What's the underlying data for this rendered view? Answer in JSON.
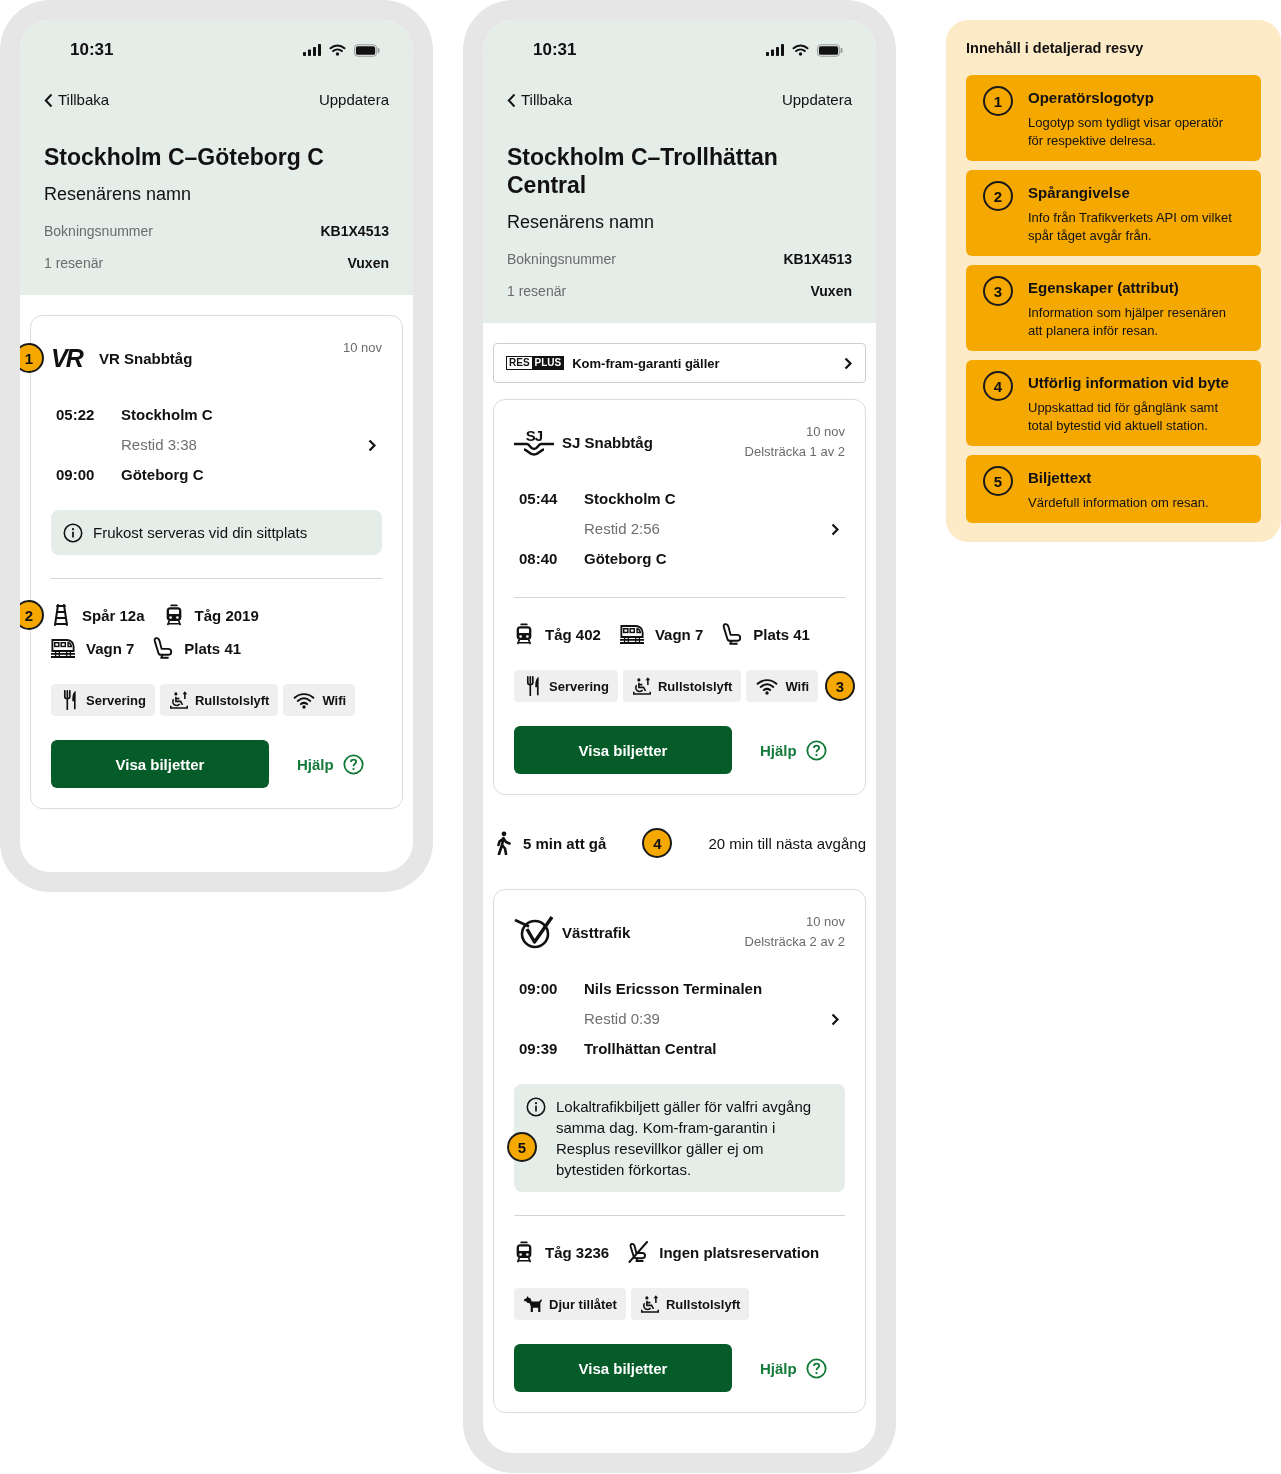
{
  "phones": [
    {
      "status_bar": {
        "time": "10:31"
      },
      "nav": {
        "back": "Tillbaka",
        "action": "Uppdatera"
      },
      "header": {
        "title": "Stockholm C–Göteborg C",
        "passenger": "Resenärens namn",
        "details": [
          {
            "label": "Bokningsnummer",
            "value": "KB1X4513"
          },
          {
            "label": "1 resenär",
            "value": "Vuxen"
          }
        ]
      },
      "sections": [
        {
          "kind": "leg",
          "operator": {
            "logo": {
              "kind": "italic-letters",
              "text": "VR"
            },
            "name": "VR Snabbtåg",
            "marker": "1"
          },
          "date": "10 nov",
          "departure": {
            "time": "05:22",
            "station": "Stockholm C"
          },
          "duration": "Restid 3:38",
          "arrival": {
            "time": "09:00",
            "station": "Göteborg C"
          },
          "notice": {
            "text": "Frukost serveras vid din sittplats"
          },
          "fact_rows": [
            {
              "marker": "2",
              "facts": [
                {
                  "kind": "track",
                  "text": "Spår 12a"
                },
                {
                  "kind": "train",
                  "text": "Tåg 2019"
                }
              ]
            },
            {
              "facts": [
                {
                  "kind": "carriage",
                  "text": "Vagn 7"
                },
                {
                  "kind": "seat",
                  "text": "Plats 41"
                }
              ]
            }
          ],
          "amenities": {
            "items": [
              {
                "kind": "dining",
                "text": "Servering"
              },
              {
                "kind": "wheelchair-lift",
                "text": "Rullstolslyft"
              },
              {
                "kind": "wifi",
                "text": "Wifi"
              }
            ]
          },
          "actions": {
            "primary": "Visa biljetter",
            "help": "Hjälp"
          }
        }
      ]
    },
    {
      "status_bar": {
        "time": "10:31"
      },
      "nav": {
        "back": "Tillbaka",
        "action": "Uppdatera"
      },
      "header": {
        "title": "Stockholm C–Trollhättan Central",
        "passenger": "Resenärens namn",
        "details": [
          {
            "label": "Bokningsnummer",
            "value": "KB1X4513"
          },
          {
            "label": "1 resenär",
            "value": "Vuxen"
          }
        ]
      },
      "sections": [
        {
          "kind": "guarantee",
          "logo_parts": [
            "RES",
            "PLUS"
          ],
          "text": "Kom-fram-garanti gäller"
        },
        {
          "kind": "leg",
          "operator": {
            "logo": {
              "kind": "letters-waves",
              "text": "SJ"
            },
            "name": "SJ Snabbtåg"
          },
          "date": "10 nov",
          "segment": "Delsträcka 1 av 2",
          "departure": {
            "time": "05:44",
            "station": "Stockholm C"
          },
          "duration": "Restid 2:56",
          "arrival": {
            "time": "08:40",
            "station": "Göteborg C"
          },
          "fact_rows": [
            {
              "facts": [
                {
                  "kind": "train",
                  "text": "Tåg 402"
                },
                {
                  "kind": "carriage",
                  "text": "Vagn 7"
                },
                {
                  "kind": "seat",
                  "text": "Plats 41"
                }
              ]
            }
          ],
          "amenities": {
            "items": [
              {
                "kind": "dining",
                "text": "Servering"
              },
              {
                "kind": "wheelchair-lift",
                "text": "Rullstolslyft"
              },
              {
                "kind": "wifi",
                "text": "Wifi"
              }
            ],
            "marker": "3"
          },
          "actions": {
            "primary": "Visa biljetter",
            "help": "Hjälp"
          }
        },
        {
          "kind": "transfer",
          "walk": "5 min att gå",
          "marker": "4",
          "wait": "20 min till nästa avgång"
        },
        {
          "kind": "leg",
          "operator": {
            "logo": {
              "kind": "ring-tick"
            },
            "name": "Västtrafik"
          },
          "date": "10 nov",
          "segment": "Delsträcka 2 av 2",
          "departure": {
            "time": "09:00",
            "station": "Nils Ericsson Terminalen"
          },
          "duration": "Restid 0:39",
          "arrival": {
            "time": "09:39",
            "station": "Trollhättan Central"
          },
          "notice": {
            "text": "Lokaltrafikbiljett gäller för valfri avgång samma dag. Kom-fram-garantin i Resplus resevillkor gäller ej om bytestiden förkortas.",
            "marker": "5"
          },
          "fact_rows": [
            {
              "facts": [
                {
                  "kind": "train",
                  "text": "Tåg 3236"
                },
                {
                  "kind": "no-seat",
                  "text": "Ingen platsreservation"
                }
              ]
            }
          ],
          "amenities": {
            "items": [
              {
                "kind": "pets",
                "text": "Djur tillåtet"
              },
              {
                "kind": "wheelchair-lift",
                "text": "Rullstolslyft"
              }
            ]
          },
          "actions": {
            "primary": "Visa biljetter",
            "help": "Hjälp"
          }
        }
      ]
    }
  ],
  "legend": {
    "title": "Innehåll i detaljerad resvy",
    "items": [
      {
        "number": "1",
        "title": "Operatörslogotyp",
        "text": "Logotyp som tydligt visar operatör för respektive delresa."
      },
      {
        "number": "2",
        "title": "Spårangivelse",
        "text": "Info från Trafikverkets API om vilket spår tåget avgår från."
      },
      {
        "number": "3",
        "title": "Egenskaper (attribut)",
        "text": "Information som hjälper resenären att planera inför resan."
      },
      {
        "number": "4",
        "title": "Utförlig information vid byte",
        "text": "Uppskattad tid för gånglänk samt total bytestid vid aktuell station."
      },
      {
        "number": "5",
        "title": "Biljettext",
        "text": "Värdefull information om resan."
      }
    ]
  }
}
